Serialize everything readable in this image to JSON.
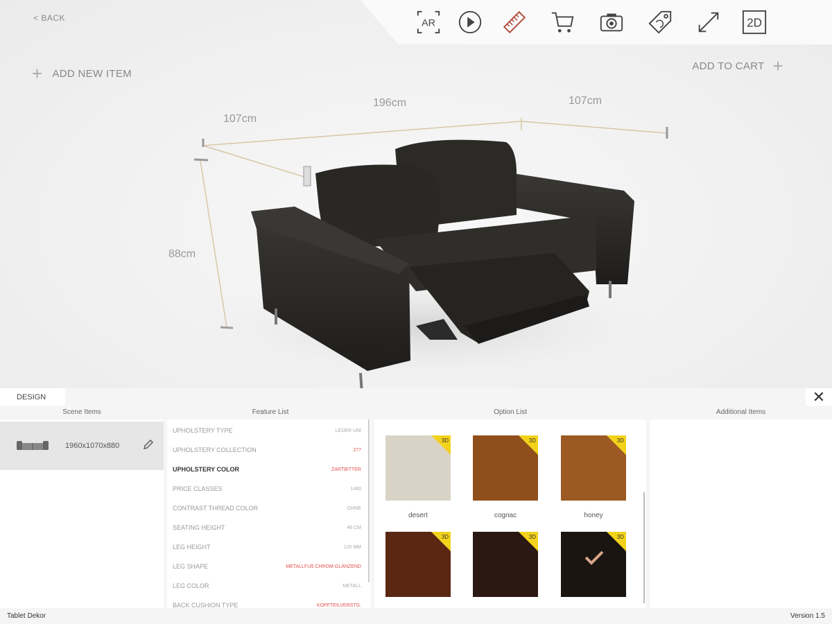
{
  "nav": {
    "back_label": "< BACK"
  },
  "toolbar": {
    "items": [
      {
        "icon": "ar-icon",
        "label": "AR"
      },
      {
        "icon": "play-icon",
        "label": ""
      },
      {
        "icon": "ruler-icon",
        "label": ""
      },
      {
        "icon": "cart-icon",
        "label": ""
      },
      {
        "icon": "camera-icon",
        "label": ""
      },
      {
        "icon": "tag-icon",
        "label": ""
      },
      {
        "icon": "expand-icon",
        "label": ""
      },
      {
        "icon": "2d-icon",
        "label": "2D"
      }
    ]
  },
  "scene": {
    "add_new_item": "ADD NEW ITEM",
    "add_to_cart": "ADD TO CART",
    "dimensions": {
      "depth_left": "107cm",
      "width": "196cm",
      "depth_right": "107cm",
      "height": "88cm"
    }
  },
  "panel": {
    "tab": "DESIGN",
    "columns": {
      "scene_items": "Scene Items",
      "feature_list": "Feature List",
      "option_list": "Option List",
      "additional_items": "Additional Items"
    },
    "scene_items": [
      {
        "dims": "1960x1070x880"
      }
    ],
    "features": [
      {
        "name": "UPHOLSTERY TYPE",
        "value": "LEDER UNI",
        "red": false,
        "active": false
      },
      {
        "name": "UPHOLSTERY COLLECTION",
        "value": "277",
        "red": true,
        "active": false
      },
      {
        "name": "UPHOLSTERY COLOR",
        "value": "ZARTBITTER",
        "red": true,
        "active": true
      },
      {
        "name": "PRICE CLASSES",
        "value": "1480",
        "red": false,
        "active": false
      },
      {
        "name": "CONTRAST THREAD COLOR",
        "value": "OHNE",
        "red": false,
        "active": false
      },
      {
        "name": "SEATING HEIGHT",
        "value": "46 CM",
        "red": false,
        "active": false
      },
      {
        "name": "LEG HEIGHT",
        "value": "120 MM",
        "red": false,
        "active": false
      },
      {
        "name": "LEG SHAPE",
        "value": "METALLFUß CHROM GLÄNZEND",
        "red": true,
        "active": false
      },
      {
        "name": "LEG COLOR",
        "value": "METALL",
        "red": false,
        "active": false
      },
      {
        "name": "BACK CUSHION TYPE",
        "value": "KOPFTEILVERSTG.",
        "red": true,
        "active": false
      }
    ],
    "options": [
      {
        "label": "desert",
        "color": "#d8d3c6",
        "badge": "3D",
        "selected": false
      },
      {
        "label": "cognac",
        "color": "#8f4f1c",
        "badge": "3D",
        "selected": false
      },
      {
        "label": "honey",
        "color": "#9c5a22",
        "badge": "3D",
        "selected": false
      },
      {
        "label": "",
        "color": "#5a2713",
        "badge": "3D",
        "selected": false
      },
      {
        "label": "",
        "color": "#2b1812",
        "badge": "3D",
        "selected": false
      },
      {
        "label": "",
        "color": "#1b1511",
        "badge": "3D",
        "selected": true
      }
    ]
  },
  "footer": {
    "left": "Tablet Dekor",
    "right": "Version 1.5"
  },
  "colors": {
    "accent_red": "#e0524c",
    "badge_yellow": "#f3d21b"
  }
}
